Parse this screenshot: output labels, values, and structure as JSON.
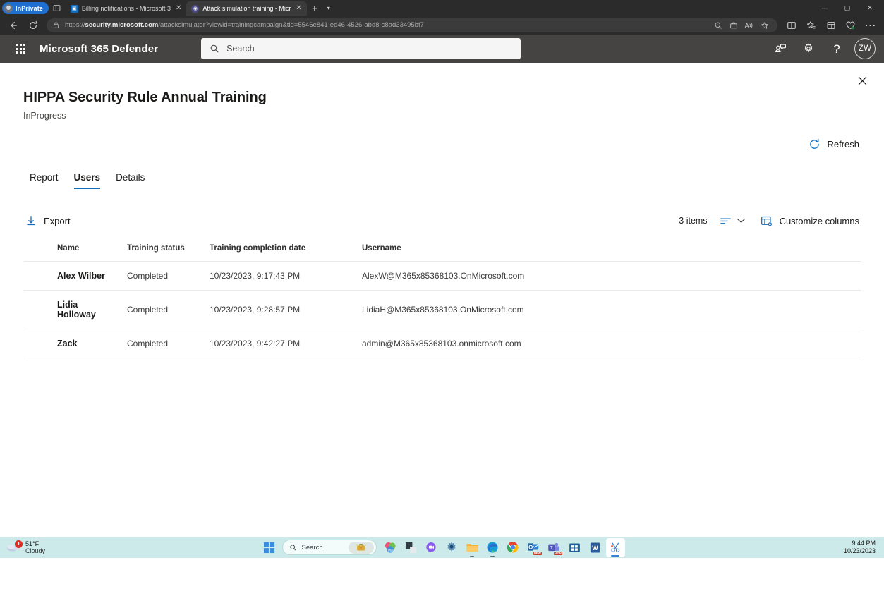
{
  "browser": {
    "inprivate_label": "InPrivate",
    "tabs": [
      {
        "title": "Billing notifications - Microsoft 3",
        "favicon": "billing-favicon",
        "active": false
      },
      {
        "title": "Attack simulation training - Micr",
        "favicon": "defender-favicon",
        "active": true
      }
    ],
    "new_tab_label": "+",
    "url_prefix": "https://",
    "url_domain": "security.microsoft.com",
    "url_path": "/attacksimulator?viewid=trainingcampaign&tid=5546e841-ed46-4526-abd8-c8ad33495bf7",
    "window_controls": {
      "minimize": "—",
      "maximize": "▢",
      "close": "✕"
    }
  },
  "app_header": {
    "title": "Microsoft 365 Defender",
    "search_placeholder": "Search",
    "avatar_initials": "ZW"
  },
  "page": {
    "title": "HIPPA Security Rule Annual Training",
    "subtitle": "InProgress",
    "refresh_label": "Refresh",
    "tabs": [
      {
        "label": "Report",
        "selected": false
      },
      {
        "label": "Users",
        "selected": true
      },
      {
        "label": "Details",
        "selected": false
      }
    ],
    "commandbar": {
      "export_label": "Export",
      "items_count": "3 items",
      "customize_columns_label": "Customize columns"
    },
    "table": {
      "columns": [
        "Name",
        "Training status",
        "Training completion date",
        "Username"
      ],
      "rows": [
        {
          "name": "Alex Wilber",
          "status": "Completed",
          "date": "10/23/2023, 9:17:43 PM",
          "username": "AlexW@M365x85368103.OnMicrosoft.com"
        },
        {
          "name": "Lidia Holloway",
          "status": "Completed",
          "date": "10/23/2023, 9:28:57 PM",
          "username": "LidiaH@M365x85368103.OnMicrosoft.com"
        },
        {
          "name": "Zack",
          "status": "Completed",
          "date": "10/23/2023, 9:42:27 PM",
          "username": "admin@M365x85368103.onmicrosoft.com"
        }
      ]
    }
  },
  "taskbar": {
    "weather_temp": "51°F",
    "weather_cond": "Cloudy",
    "weather_badge": "1",
    "search_placeholder": "Search",
    "time": "9:44 PM",
    "date": "10/23/2023"
  },
  "colors": {
    "accent": "#0f6cbd",
    "header_bg": "#464442",
    "chrome_bg": "#2b2b2b",
    "taskbar_bg": "#cdeaea"
  }
}
